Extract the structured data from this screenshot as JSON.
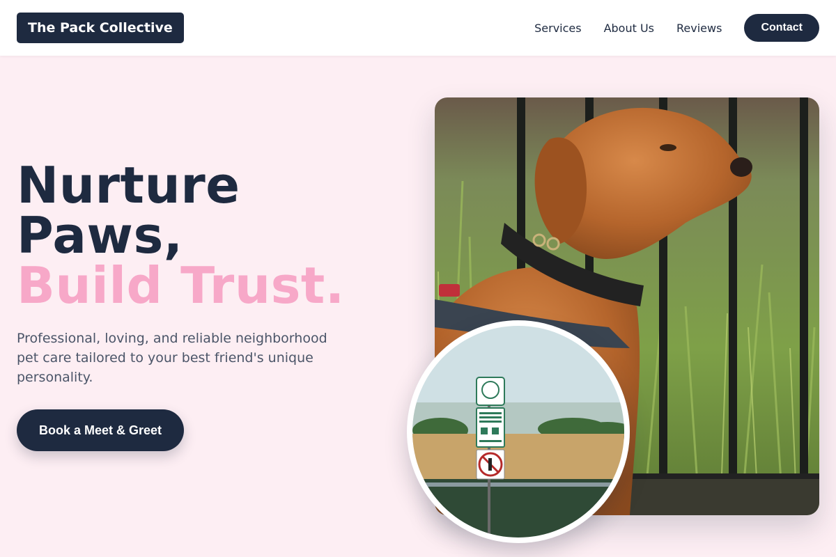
{
  "header": {
    "logo": "The Pack Collective",
    "nav": [
      {
        "label": "Services"
      },
      {
        "label": "About Us"
      },
      {
        "label": "Reviews"
      }
    ],
    "contact_label": "Contact"
  },
  "hero": {
    "title_line1": "Nurture",
    "title_line2": "Paws,",
    "title_accent": "Build Trust.",
    "subtitle": "Professional, loving, and reliable neighborhood pet care tailored to your best friend's unique personality.",
    "cta_label": "Book a Meet & Greet"
  },
  "images": {
    "main": "dog-photo",
    "inset": "park-sign-photo",
    "sign_text": [
      "Please leash",
      "and clean up",
      "after your dog",
      "Max Fine $248"
    ]
  },
  "colors": {
    "navy": "#1e2a40",
    "pink_bg": "#fdeef3",
    "accent_pink": "#f7a8c8",
    "body_text": "#4b5568"
  }
}
